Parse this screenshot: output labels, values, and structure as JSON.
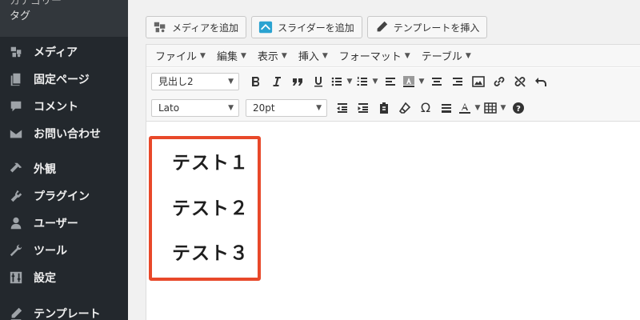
{
  "sidebar": {
    "sub_items": [
      {
        "label": "カテゴリー"
      },
      {
        "label": "タグ"
      }
    ],
    "items": [
      {
        "label": "メディア",
        "icon": "media-icon"
      },
      {
        "label": "固定ページ",
        "icon": "page-icon"
      },
      {
        "label": "コメント",
        "icon": "comment-icon"
      },
      {
        "label": "お問い合わせ",
        "icon": "mail-icon"
      },
      {
        "label": "外観",
        "icon": "appearance-icon"
      },
      {
        "label": "プラグイン",
        "icon": "plugin-icon"
      },
      {
        "label": "ユーザー",
        "icon": "user-icon"
      },
      {
        "label": "ツール",
        "icon": "wrench-icon"
      },
      {
        "label": "設定",
        "icon": "settings-icon"
      },
      {
        "label": "テンプレート",
        "icon": "pencil-icon"
      }
    ]
  },
  "media_buttons": {
    "add_media": "メディアを追加",
    "add_slider": "スライダーを追加",
    "insert_template": "テンプレートを挿入"
  },
  "menubar": {
    "file": "ファイル",
    "edit": "編集",
    "view": "表示",
    "insert": "挿入",
    "format": "フォーマット",
    "table": "テーブル"
  },
  "toolbar": {
    "block_format": "見出し2",
    "font_family": "Lato",
    "font_size": "20pt"
  },
  "content": {
    "lines": [
      "テスト１",
      "テスト２",
      "テスト３"
    ]
  },
  "colors": {
    "sidebar_bg": "#23282d",
    "highlight": "#e8492a"
  }
}
